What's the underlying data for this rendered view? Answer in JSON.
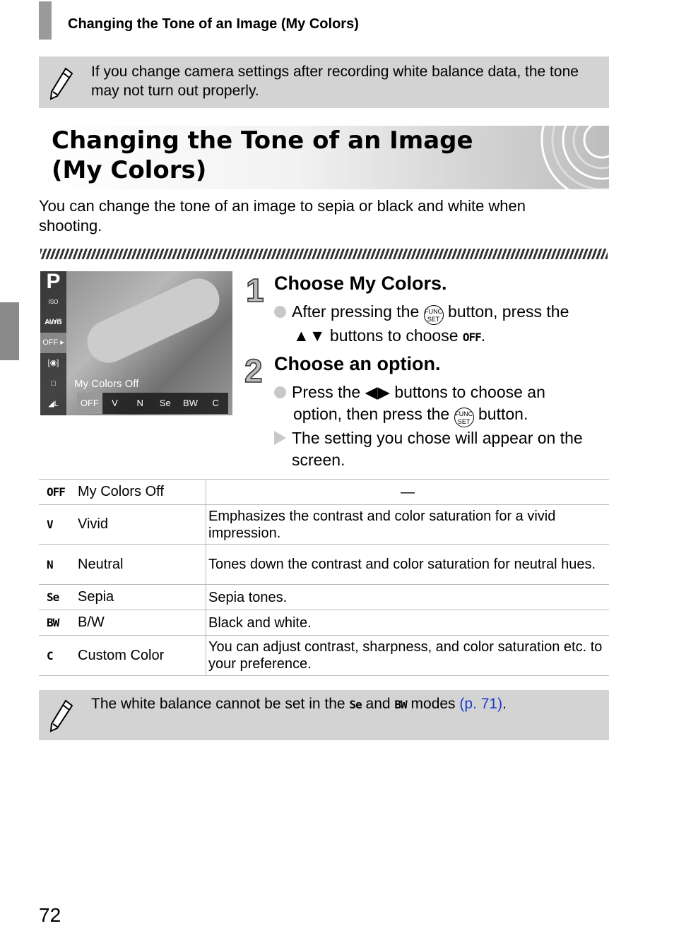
{
  "header": {
    "title": "Changing the Tone of an Image (My Colors)"
  },
  "note_top": {
    "icon": "pencil-icon",
    "text": "If you change camera settings after recording white balance data, the tone may not turn out properly."
  },
  "section": {
    "title_line1": "Changing the Tone of an Image",
    "title_line2": "(My Colors)",
    "intro": "You can change the tone of an image to sepia or black and white when shooting."
  },
  "camera_screen": {
    "mode": "P",
    "side_icons": [
      "ISO AUTO",
      "AWB",
      "OFF ▸",
      "[◉]",
      "□",
      "◢L"
    ],
    "label": "My Colors Off",
    "options": [
      "OFF",
      "V",
      "N",
      "Se",
      "BW",
      "C"
    ],
    "selected": "OFF"
  },
  "steps": [
    {
      "number": "1",
      "title": "Choose My Colors.",
      "text_a": "After pressing the",
      "func": "FUNC SET",
      "text_b": "button, press the",
      "arrows": "▲▼",
      "text_c": "buttons to choose",
      "icon": "OFF",
      "text_d": "."
    },
    {
      "number": "2",
      "title": "Choose an option.",
      "text_a": "Press the",
      "arrows": "◀▶",
      "text_b": "buttons to choose an",
      "text_c": "option, then press the",
      "func": "FUNC SET",
      "text_d": "button.",
      "result": "The setting you chose will appear on the screen."
    }
  ],
  "table": {
    "rows": [
      {
        "icon": "OFF",
        "name": "My Colors Off",
        "desc": "—"
      },
      {
        "icon": "V",
        "name": "Vivid",
        "desc": "Emphasizes the contrast and color saturation for a vivid impression."
      },
      {
        "icon": "N",
        "name": "Neutral",
        "desc": "Tones down the contrast and color saturation for neutral hues."
      },
      {
        "icon": "Se",
        "name": "Sepia",
        "desc": "Sepia tones."
      },
      {
        "icon": "BW",
        "name": "B/W",
        "desc": "Black and white."
      },
      {
        "icon": "C",
        "name": "Custom Color",
        "desc": "You can adjust contrast, sharpness, and color saturation etc. to your preference."
      }
    ]
  },
  "note_bottom": {
    "icon": "pencil-icon",
    "text_a": "The white balance cannot be set in the",
    "icon1": "Se",
    "text_b": "and",
    "icon2": "BW",
    "text_c": "modes",
    "link": "(p. 71)",
    "text_d": "."
  },
  "page_number": "72"
}
